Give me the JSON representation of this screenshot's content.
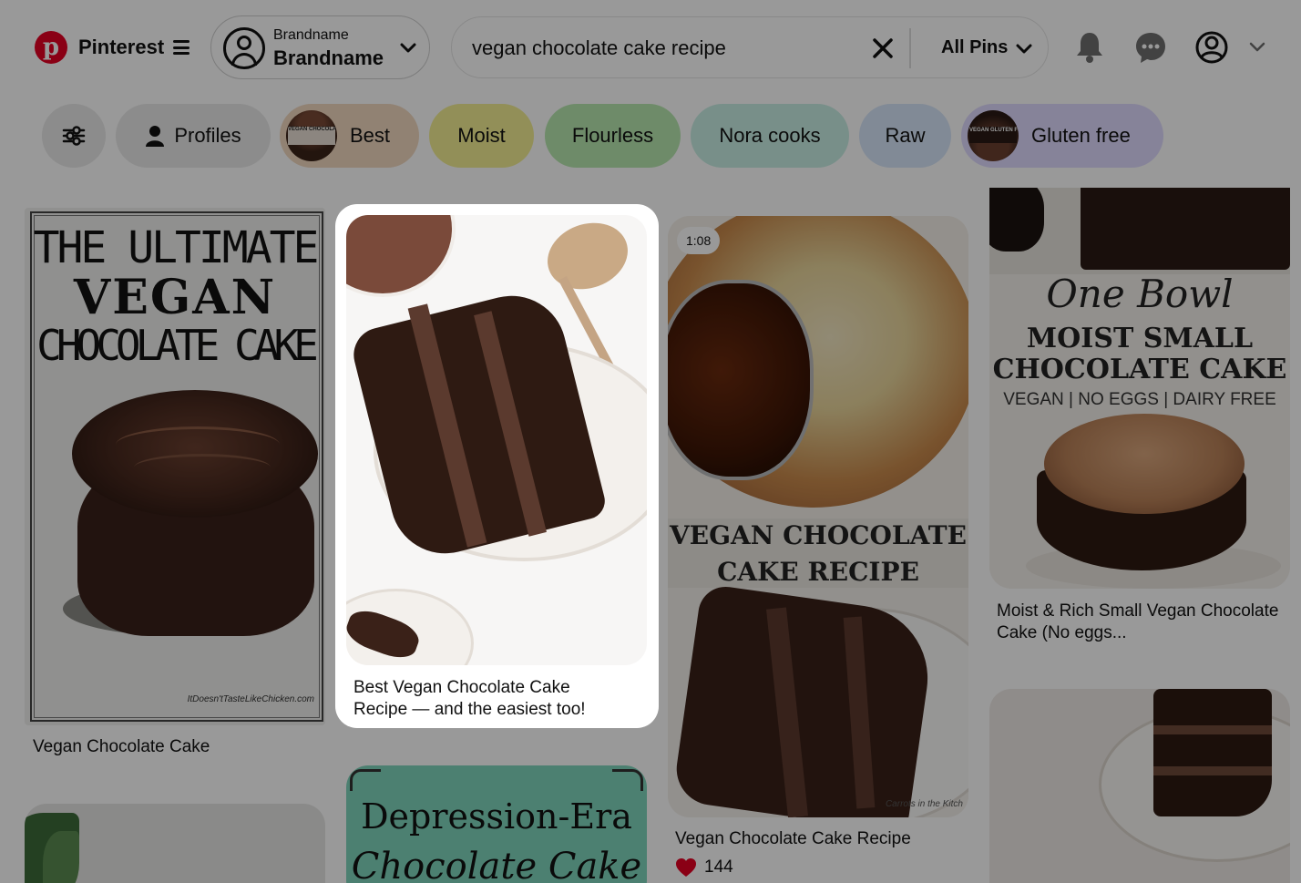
{
  "header": {
    "brand": "Pinterest",
    "account": {
      "small_name": "Brandname",
      "big_name": "Brandname"
    },
    "search": {
      "value": "vegan chocolate cake recipe",
      "filter_label": "All Pins"
    }
  },
  "filters": [
    {
      "label": "Profiles",
      "color": "#e9e9e9"
    },
    {
      "label": "Best",
      "color": "#f2d9c0"
    },
    {
      "label": "Moist",
      "color": "#f3ef93"
    },
    {
      "label": "Flourless",
      "color": "#b8e8b0"
    },
    {
      "label": "Nora cooks",
      "color": "#c8efe5"
    },
    {
      "label": "Raw",
      "color": "#d8e7fa"
    },
    {
      "label": "Gluten free",
      "color": "#e0dbff"
    }
  ],
  "filter_thumbs": {
    "best": "VEGAN CHOCOLATE LAYER CAKE",
    "gluten_free": "VEGAN GLUTEN FREE CHOCOLATE CAKE"
  },
  "pins": [
    {
      "title": "Vegan Chocolate Cake",
      "image_text": {
        "line1": "THE ULTIMATE",
        "line2": "VEGAN",
        "line3": "CHOCOLATE CAKE",
        "credit": "ItDoesn'tTasteLikeChicken.com"
      }
    },
    {
      "title": "Best Vegan Chocolate Cake Recipe — and the easiest too!"
    },
    {
      "title": "Vegan Chocolate Cake Recipe",
      "duration": "1:08",
      "image_text": {
        "line1": "VEGAN CHOCOLATE",
        "line2": "CAKE RECIPE",
        "credit": "Carrots in the Kitch"
      },
      "reactions": "144"
    },
    {
      "title": "Moist & Rich Small Vegan Chocolate Cake (No eggs...",
      "image_text": {
        "line1": "One Bowl",
        "line2": "MOIST SMALL",
        "line3": "CHOCOLATE CAKE",
        "line4": "VEGAN | NO EGGS | DAIRY FREE"
      }
    },
    {
      "title": ""
    },
    {
      "title": "",
      "image_text": {
        "line1": "Depression-Era",
        "line2": "Chocolate Cake"
      }
    },
    {
      "title": ""
    }
  ],
  "colors": {
    "brand": "#e60023",
    "overlay": "rgba(0,0,0,0.40)"
  }
}
